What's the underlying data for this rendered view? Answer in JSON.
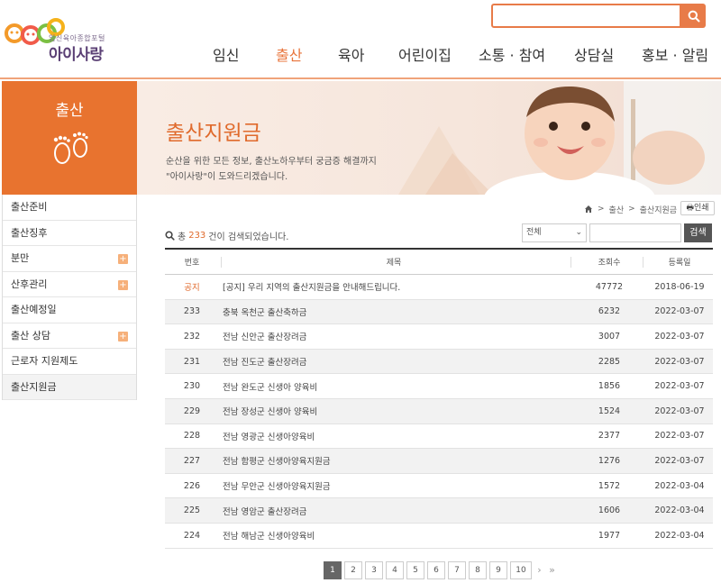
{
  "header": {
    "logo_sub": "임신육아종합포털",
    "logo_main": "아이사랑",
    "search_placeholder": "",
    "nav": [
      {
        "label": "임신",
        "active": false
      },
      {
        "label": "출산",
        "active": true
      },
      {
        "label": "육아",
        "active": false
      },
      {
        "label": "어린이집",
        "active": false
      },
      {
        "label": "소통 · 참여",
        "active": false
      },
      {
        "label": "상담실",
        "active": false
      },
      {
        "label": "홍보 · 알림",
        "active": false
      }
    ]
  },
  "sidebar": {
    "title": "출산",
    "items": [
      {
        "label": "출산준비",
        "expandable": false,
        "active": false
      },
      {
        "label": "출산징후",
        "expandable": false,
        "active": false
      },
      {
        "label": "분만",
        "expandable": true,
        "active": false
      },
      {
        "label": "산후관리",
        "expandable": true,
        "active": false
      },
      {
        "label": "출산예정일",
        "expandable": false,
        "active": false
      },
      {
        "label": "출산 상담",
        "expandable": true,
        "active": false
      },
      {
        "label": "근로자 지원제도",
        "expandable": false,
        "active": false
      },
      {
        "label": "출산지원금",
        "expandable": false,
        "active": true
      }
    ],
    "plus_symbol": "+"
  },
  "banner": {
    "title": "출산지원금",
    "desc_line1": "순산을 위한 모든 정보, 출산노하우부터 궁금증 해결까지",
    "desc_line2": "\"아이사랑\"이 도와드리겠습니다."
  },
  "breadcrumb": {
    "items": [
      "출산",
      "출산지원금"
    ],
    "separator": ">",
    "print_label": "인쇄"
  },
  "list": {
    "count_prefix": "총",
    "count": "233",
    "count_suffix": "건이 검색되었습니다.",
    "filter_selected": "전체",
    "filter_input_value": "",
    "search_button": "검색",
    "headers": {
      "no": "번호",
      "title": "제목",
      "views": "조회수",
      "date": "등록일"
    },
    "rows": [
      {
        "no": "공지",
        "title": "[공지] 우리 지역의 출산지원금을 안내해드립니다.",
        "views": "47772",
        "date": "2018-06-19",
        "notice": true
      },
      {
        "no": "233",
        "title": "충북 옥천군 출산축하금",
        "views": "6232",
        "date": "2022-03-07",
        "notice": false
      },
      {
        "no": "232",
        "title": "전남 신안군 출산장려금",
        "views": "3007",
        "date": "2022-03-07",
        "notice": false
      },
      {
        "no": "231",
        "title": "전남 진도군 출산장려금",
        "views": "2285",
        "date": "2022-03-07",
        "notice": false
      },
      {
        "no": "230",
        "title": "전남 완도군 신생아 양육비",
        "views": "1856",
        "date": "2022-03-07",
        "notice": false
      },
      {
        "no": "229",
        "title": "전남 장성군 신생아 양육비",
        "views": "1524",
        "date": "2022-03-07",
        "notice": false
      },
      {
        "no": "228",
        "title": "전남 영광군 신생아양육비",
        "views": "2377",
        "date": "2022-03-07",
        "notice": false
      },
      {
        "no": "227",
        "title": "전남 함평군 신생아양육지원금",
        "views": "1276",
        "date": "2022-03-07",
        "notice": false
      },
      {
        "no": "226",
        "title": "전남 무안군 신생아양육지원금",
        "views": "1572",
        "date": "2022-03-04",
        "notice": false
      },
      {
        "no": "225",
        "title": "전남 영암군 출산장려금",
        "views": "1606",
        "date": "2022-03-04",
        "notice": false
      },
      {
        "no": "224",
        "title": "전남 해남군 신생아양육비",
        "views": "1977",
        "date": "2022-03-04",
        "notice": false
      }
    ]
  },
  "pagination": {
    "pages": [
      "1",
      "2",
      "3",
      "4",
      "5",
      "6",
      "7",
      "8",
      "9",
      "10"
    ],
    "current": "1",
    "next": "›",
    "last": "»"
  },
  "colors": {
    "accent": "#e8732f",
    "nav_active": "#e8743b",
    "banner_bg": "#f9ece4"
  }
}
